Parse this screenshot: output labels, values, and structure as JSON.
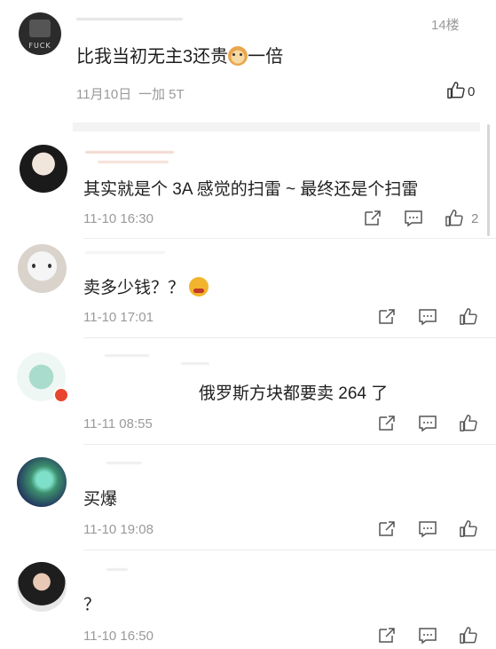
{
  "top_comment": {
    "floor": "14楼",
    "text_before": "比我当初无主3还贵",
    "text_after": "一倍",
    "emoji": "dog-emoji",
    "date": "11月10日",
    "source": "一加 5T",
    "likes": "0",
    "avatar_text": "FUCK"
  },
  "replies": [
    {
      "text": "其实就是个 3A 感觉的扫雷 ~ 最终还是个扫雷",
      "time": "11-10 16:30",
      "likes": "2"
    },
    {
      "text": "卖多少钱？？",
      "emoji": "angry-emoji",
      "time": "11-10 17:01",
      "likes": ""
    },
    {
      "text": "俄罗斯方块都要卖 264 了",
      "time": "11-11 08:55",
      "likes": ""
    },
    {
      "text": "买爆",
      "time": "11-10 19:08",
      "likes": ""
    },
    {
      "text": "？",
      "time": "11-10 16:50",
      "likes": ""
    }
  ],
  "colors": {
    "accent": "#222222",
    "meta": "#9a9a9a",
    "badge": "#e8452e"
  }
}
